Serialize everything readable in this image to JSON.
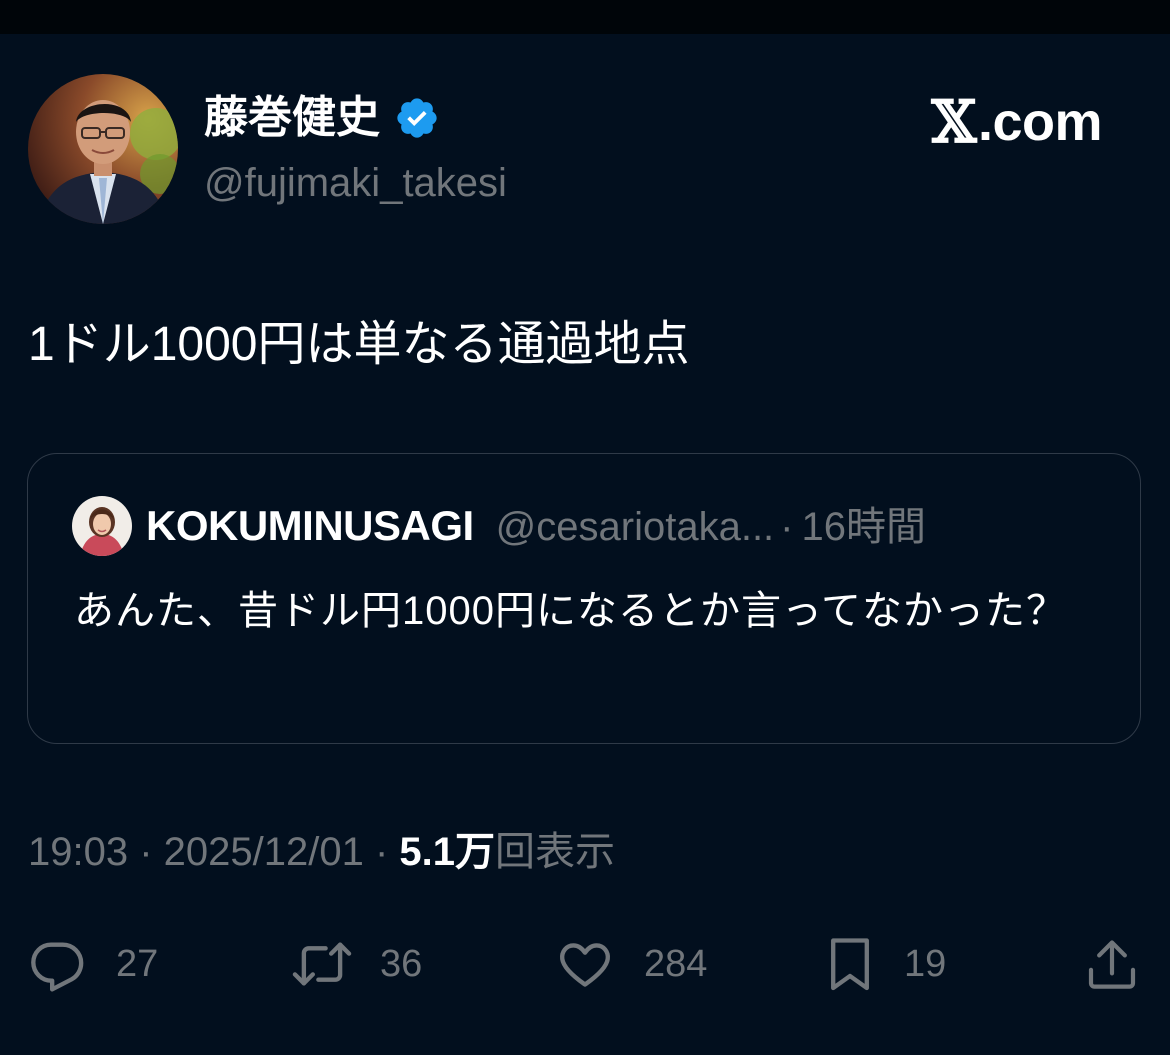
{
  "author": {
    "display_name": "藤巻健史",
    "handle": "@fujimaki_takesi",
    "verified_icon": "verified-badge-icon",
    "avatar": "profile-photo"
  },
  "brand": {
    "x_glyph": "𝕏",
    "domain": ".com"
  },
  "tweet": {
    "text": "1ドル1000円は単なる通過地点"
  },
  "quote": {
    "name": "KOKUMINUSAGI",
    "handle": "@cesariotaka...",
    "separator": "·",
    "time": "16時間",
    "text": "あんた、昔ドル円1000円になるとか言ってなかった？"
  },
  "meta": {
    "time": "19:03",
    "sep1": " · ",
    "date": "2025/12/01",
    "sep2": " · ",
    "views_count": "5.1万",
    "views_label": "回表示"
  },
  "actions": {
    "replies": "27",
    "reposts": "36",
    "likes": "284",
    "bookmarks": "19"
  },
  "colors": {
    "background": "#020f1e",
    "muted": "#71767b",
    "verified": "#1d9bf0",
    "border": "#2f3a48"
  }
}
